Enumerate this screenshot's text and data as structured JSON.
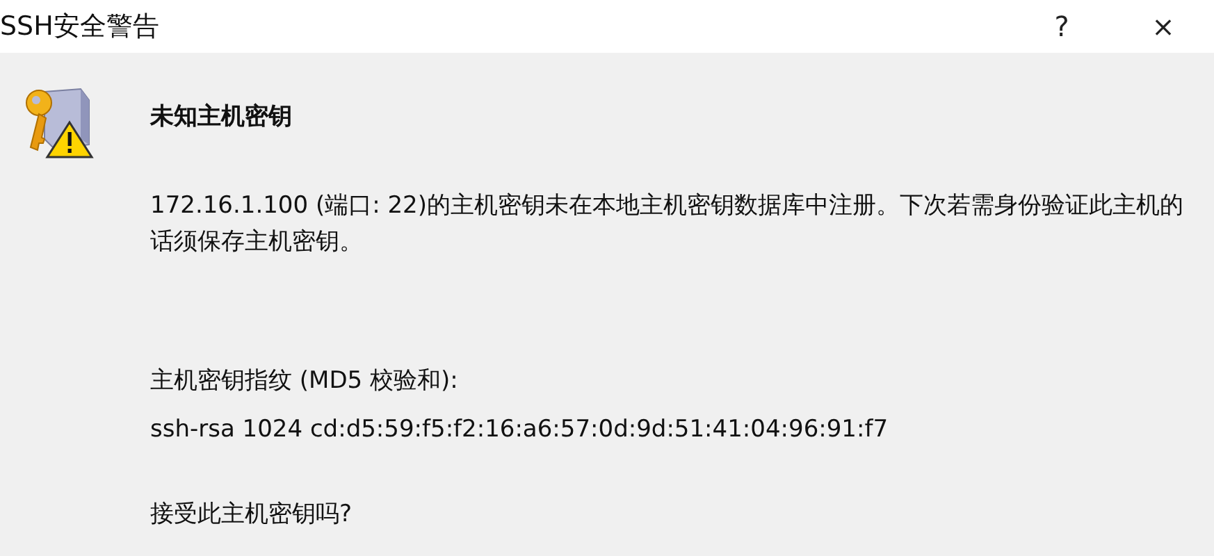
{
  "window": {
    "title": "SSH安全警告",
    "help": "?",
    "close": "×"
  },
  "heading": "未知主机密钥",
  "message": "172.16.1.100 (端口: 22)的主机密钥未在本地主机密钥数据库中注册。下次若需身份验证此主机的话须保存主机密钥。",
  "fingerprint_label": "主机密钥指纹 (MD5 校验和):",
  "fingerprint": "ssh-rsa 1024 cd:d5:59:f5:f2:16:a6:57:0d:9d:51:41:04:96:91:f7",
  "question": "接受此主机密钥吗?"
}
